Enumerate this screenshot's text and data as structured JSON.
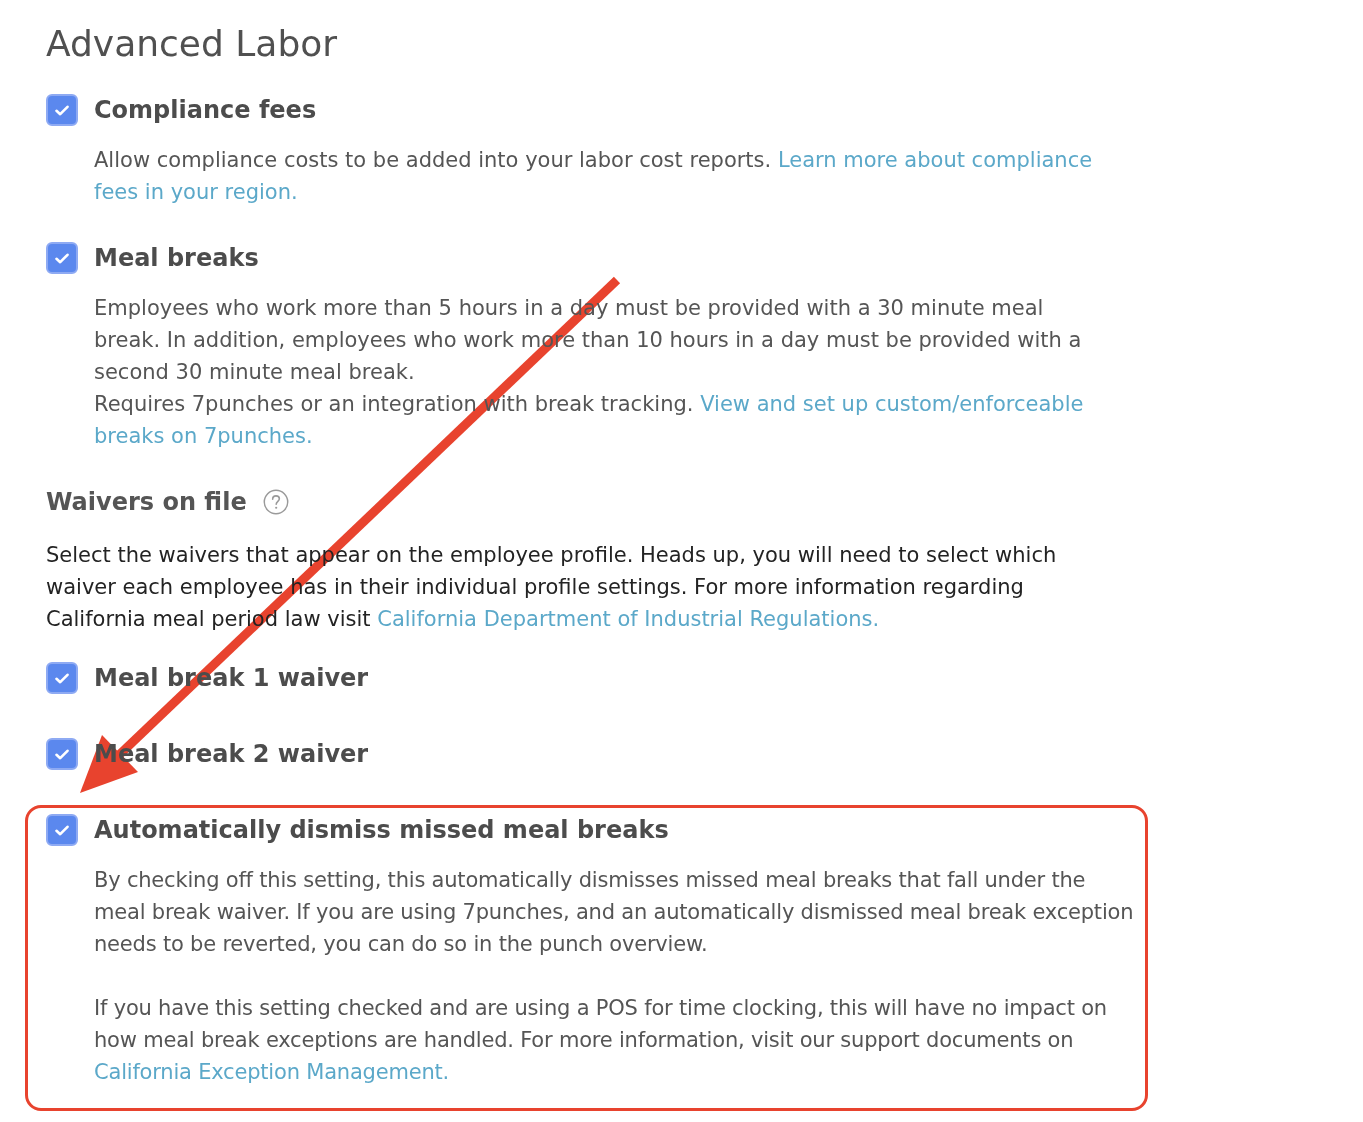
{
  "title": "Advanced Labor",
  "settings": [
    {
      "label": "Compliance fees",
      "checked": true,
      "highlighted": false,
      "paragraphs": [
        {
          "parts": [
            {
              "text": "Allow compliance costs to be added into your labor cost reports.",
              "links": [
                "Learn more about compliance",
                "fees in your region."
              ]
            }
          ]
        }
      ]
    },
    {
      "label": "Meal breaks",
      "checked": true,
      "highlighted": false,
      "paragraphs": [
        {
          "parts": [
            {
              "text": "Employees who work more than 5 hours in a day must be provided with a 30 minute meal break. In addition, employees who work more than 10 hours in a day must be provided with a second 30 minute meal break."
            },
            {
              "text": "Requires 7punches or an integration with break tracking.",
              "links": [
                "View and set up custom/enforceable",
                "breaks on 7punches."
              ]
            }
          ]
        }
      ]
    }
  ],
  "waivers": {
    "heading": "Waivers on file",
    "intro": {
      "text": "Select the waivers that appear on the employee profile. Heads up, you will need to select which waiver each employee has in their individual profile settings. For more information regarding California meal period law visit",
      "links": [
        "California Department of Industrial Regulations."
      ]
    },
    "options": [
      {
        "label": "Meal break 1 waiver",
        "checked": true,
        "highlighted": false
      },
      {
        "label": "Meal break 2 waiver",
        "checked": true,
        "highlighted": false
      },
      {
        "label": "Automatically dismiss missed meal breaks",
        "checked": true,
        "highlighted": true,
        "paragraphs": [
          {
            "parts": [
              {
                "text": "By checking off this setting, this automatically dismisses missed meal breaks that fall under the meal break waiver. If you are using 7punches, and an automatically dismissed meal break exception needs to be reverted, you can do so in the punch overview."
              }
            ]
          },
          {
            "parts": [
              {
                "text": "If you have this setting checked and are using a POS for time clocking, this will have no impact on how meal break exceptions are handled. For more information, visit our support documents on",
                "links": [
                  "California Exception Management."
                ]
              }
            ]
          }
        ]
      }
    ]
  }
}
